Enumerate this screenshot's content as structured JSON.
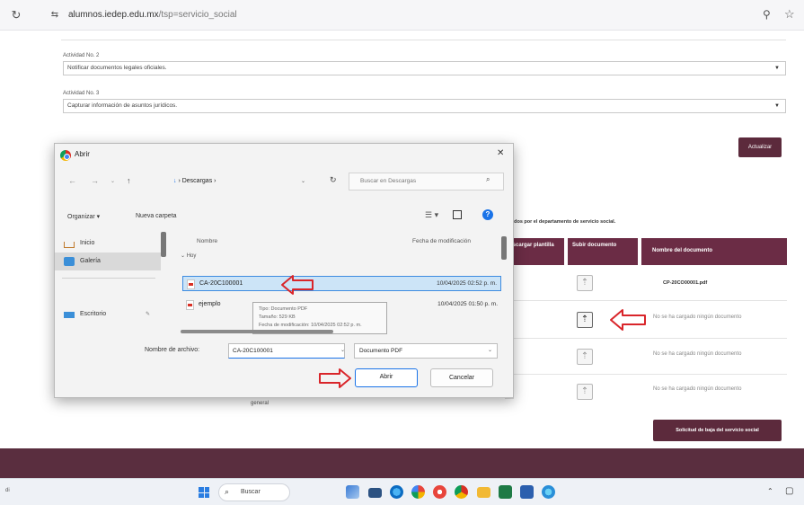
{
  "browser": {
    "url_host": "alumnos.iedep.edu.mx",
    "url_path": "/tsp=servicio_social"
  },
  "form": {
    "activity2_label": "Actividad No. 2",
    "activity2_value": "Notificar documentos legales oficiales.",
    "activity3_label": "Actividad No. 3",
    "activity3_value": "Capturar información de asuntos jurídicos.",
    "update_button": "Actualizar"
  },
  "documents": {
    "caption": "...idos por el departamento de servicio social.",
    "headers": [
      "Descargar plantilla",
      "Subir documento",
      "Nombre del documento"
    ],
    "rows": [
      {
        "filename": "CP-20CO00001.pdf",
        "no_doc": ""
      },
      {
        "filename": "",
        "no_doc": "No se ha cargado ningún documento"
      },
      {
        "filename": "",
        "no_doc": "No se ha cargado ningún documento"
      },
      {
        "filename": "",
        "no_doc": "No se ha cargado ningún documento"
      }
    ],
    "row4_partial_label": "general",
    "baja_button": "Solicitud de baja del servicio social"
  },
  "dialog": {
    "title": "Abrir",
    "path_arrow": "↓",
    "path": "› Descargas ›",
    "search_placeholder": "Buscar en Descargas",
    "organize": "Organizar ▾",
    "new_folder": "Nueva carpeta",
    "nav_items": [
      "Inicio",
      "Galería",
      "Escritorio"
    ],
    "col_name": "Nombre",
    "col_date": "Fecha de modificación",
    "group_label": "Hoy",
    "files": [
      {
        "name": "CA-20C100001",
        "date": "10/04/2025 02:52 p. m."
      },
      {
        "name": "ejemplo",
        "date": "10/04/2025 01:50 p. m."
      }
    ],
    "tooltip_lines": [
      "Tipo: Documento PDF",
      "Tamaño: 529 KB",
      "Fecha de modificación: 10/04/2025 02:52 p. m."
    ],
    "filename_label": "Nombre de archivo:",
    "filename_value": "CA-20C100001",
    "filetype_value": "Documento PDF",
    "open_button": "Abrir",
    "cancel_button": "Cancelar"
  },
  "taskbar": {
    "search_label": "Buscar",
    "left_text": "di"
  },
  "colors": {
    "brand": "#5c2a3c",
    "table_header": "#6b2c45",
    "annotation_red": "#d9252a",
    "selection": "#cce4f7"
  },
  "icons": [
    "reload-icon",
    "site-info-icon",
    "zoom-icon",
    "star-icon",
    "chrome-icon",
    "close-icon",
    "search-icon",
    "upload-icon",
    "pdf-file-icon",
    "help-icon",
    "windows-start-icon"
  ]
}
